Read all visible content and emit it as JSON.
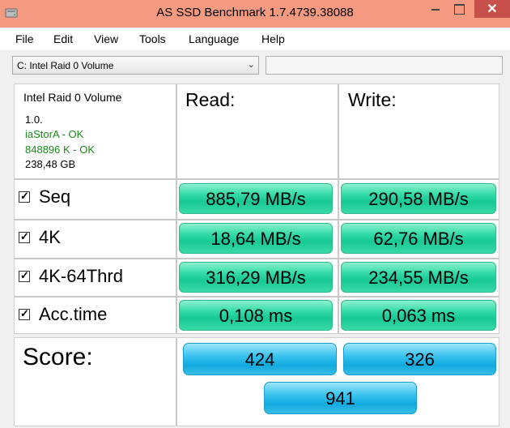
{
  "window": {
    "title": "AS SSD Benchmark 1.7.4739.38088",
    "close_glyph": "✕",
    "accent": "#f49a80"
  },
  "menu": {
    "items": [
      "File",
      "Edit",
      "View",
      "Tools",
      "Language",
      "Help"
    ]
  },
  "drive": {
    "selected": "C: Intel Raid 0 Volume",
    "text_value": ""
  },
  "info": {
    "name": "Intel Raid 0 Volume",
    "lines": [
      "1.0.",
      "iaStorA - OK",
      "848896 K - OK",
      "238,48 GB"
    ],
    "ok_color": "#1a8a1a"
  },
  "columns": {
    "read": "Read:",
    "write": "Write:"
  },
  "rows": [
    {
      "label": "Seq",
      "checked": true,
      "read": "885,79 MB/s",
      "write": "290,58 MB/s"
    },
    {
      "label": "4K",
      "checked": true,
      "read": "18,64 MB/s",
      "write": "62,76 MB/s"
    },
    {
      "label": "4K-64Thrd",
      "checked": true,
      "read": "316,29 MB/s",
      "write": "234,55 MB/s"
    },
    {
      "label": "Acc.time",
      "checked": true,
      "read": "0,108 ms",
      "write": "0,063 ms"
    }
  ],
  "score": {
    "label": "Score:",
    "read": "424",
    "write": "326",
    "total": "941"
  },
  "colors": {
    "result_green": "#17c994",
    "score_blue": "#11a9de"
  }
}
